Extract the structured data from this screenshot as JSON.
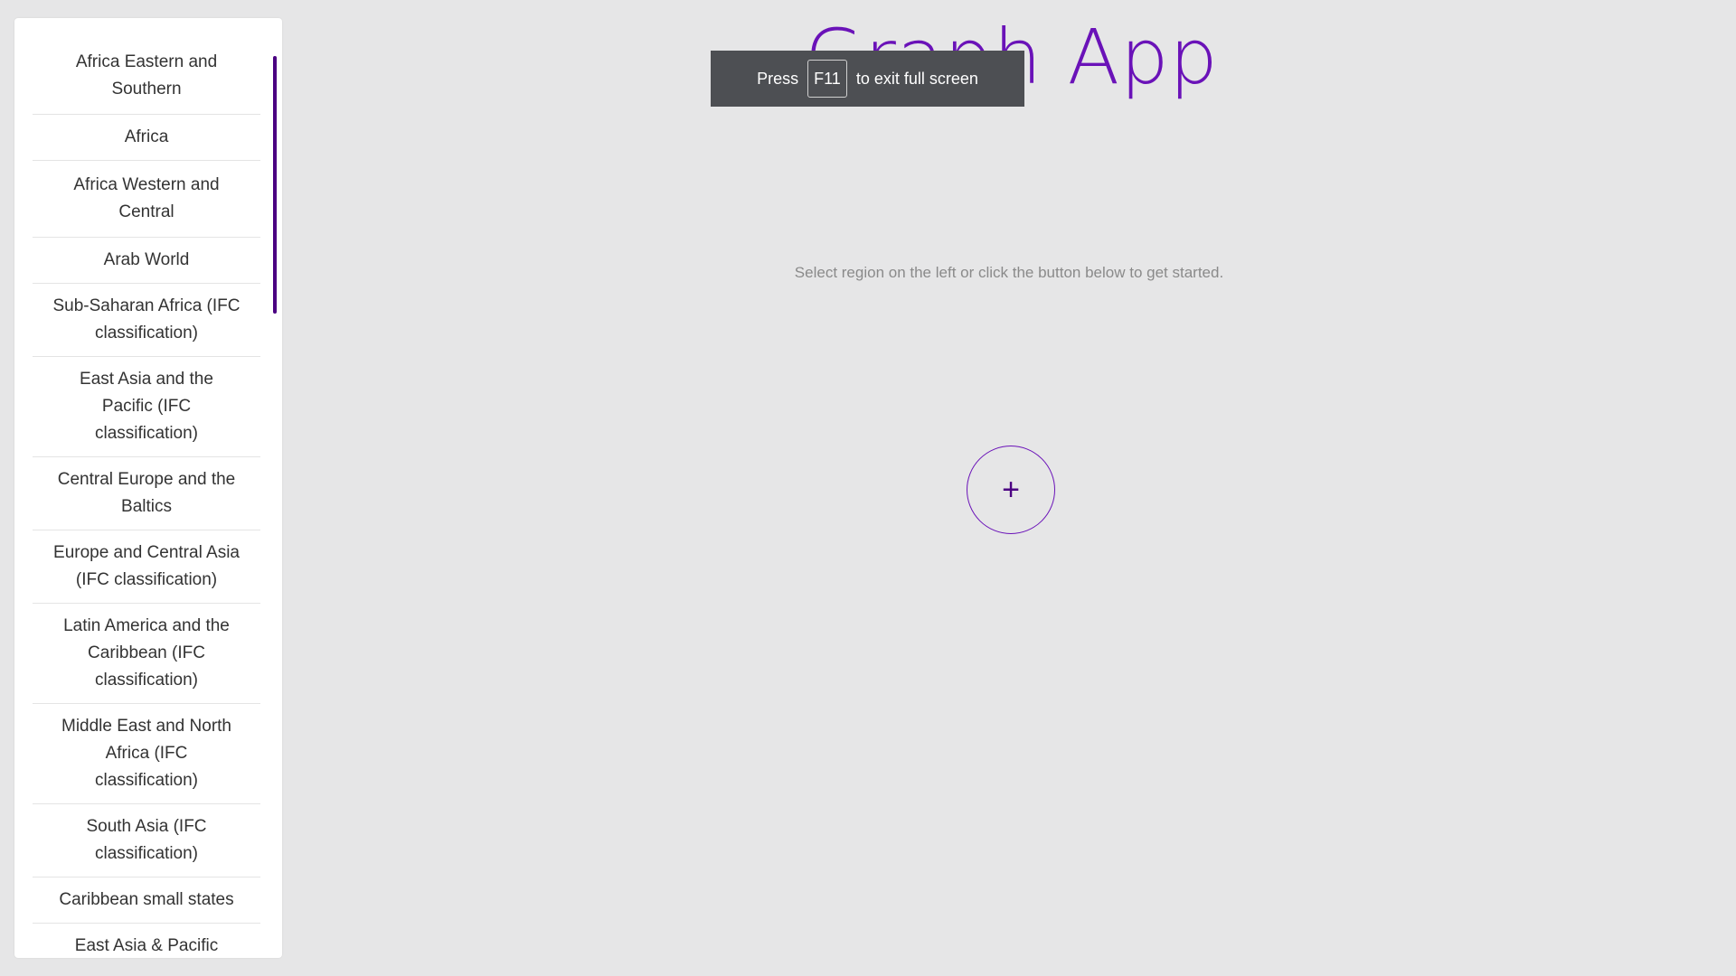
{
  "app": {
    "title": "Graph App",
    "hint": "Select region on the left or click the button below to get started.",
    "add_button_symbol": "+",
    "accent_color": "#6a12b8"
  },
  "fullscreen_toast": {
    "press": "Press",
    "key": "F11",
    "suffix": "to exit full screen"
  },
  "sidebar": {
    "regions": [
      "Africa Eastern and Southern",
      "Africa",
      "Africa Western and Central",
      "Arab World",
      "Sub-Saharan Africa (IFC classification)",
      "East Asia and the Pacific (IFC classification)",
      "Central Europe and the Baltics",
      "Europe and Central Asia (IFC classification)",
      "Latin America and the Caribbean (IFC classification)",
      "Middle East and North Africa (IFC classification)",
      "South Asia (IFC classification)",
      "Caribbean small states",
      "East Asia & Pacific"
    ]
  }
}
